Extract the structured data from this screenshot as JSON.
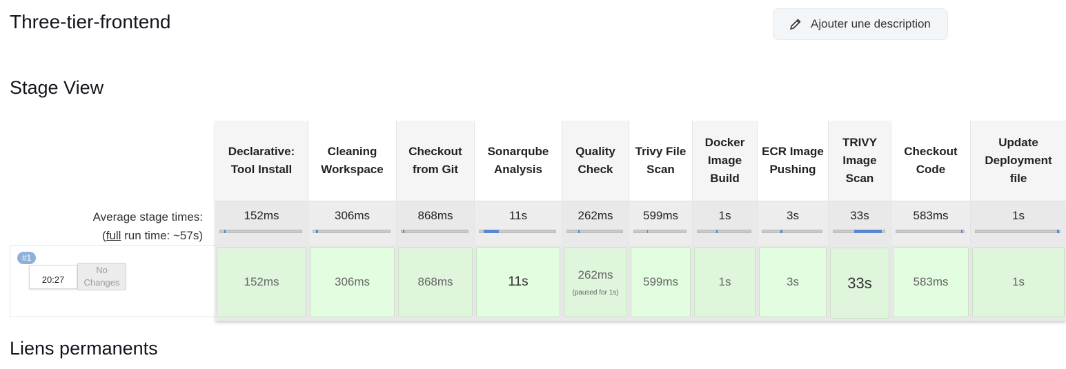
{
  "page": {
    "title": "Three-tier-frontend"
  },
  "actions": {
    "add_description_label": "Ajouter une description"
  },
  "sections": {
    "stage_view_title": "Stage View",
    "permalinks_title": "Liens permanents"
  },
  "stage_view": {
    "average_label_line1": "Average stage times:",
    "average_label_full": "full",
    "average_label_rest": " run time: ~57s)",
    "stages": [
      {
        "name": "Declarative: Tool Install",
        "avg": "152ms",
        "cell": "152ms",
        "note": ""
      },
      {
        "name": "Cleaning Workspace",
        "avg": "306ms",
        "cell": "306ms",
        "note": ""
      },
      {
        "name": "Checkout from Git",
        "avg": "868ms",
        "cell": "868ms",
        "note": ""
      },
      {
        "name": "Sonarqube Analysis",
        "avg": "11s",
        "cell": "11s",
        "note": ""
      },
      {
        "name": "Quality Check",
        "avg": "262ms",
        "cell": "262ms",
        "note": "(paused for 1s)"
      },
      {
        "name": "Trivy File Scan",
        "avg": "599ms",
        "cell": "599ms",
        "note": ""
      },
      {
        "name": "Docker Image Build",
        "avg": "1s",
        "cell": "1s",
        "note": ""
      },
      {
        "name": "ECR Image Pushing",
        "avg": "3s",
        "cell": "3s",
        "note": ""
      },
      {
        "name": "TRIVY Image Scan",
        "avg": "33s",
        "cell": "33s",
        "note": ""
      },
      {
        "name": "Checkout Code",
        "avg": "583ms",
        "cell": "583ms",
        "note": ""
      },
      {
        "name": "Update Deployment file",
        "avg": "1s",
        "cell": "1s",
        "note": ""
      }
    ]
  },
  "build": {
    "number": "#1",
    "time": "20:27",
    "changes_line1": "No",
    "changes_line2": "Changes"
  },
  "colors": {
    "success_cell": "#dff5dc",
    "progress_fill": "#5b87d0",
    "badge": "#8fb0d9"
  }
}
